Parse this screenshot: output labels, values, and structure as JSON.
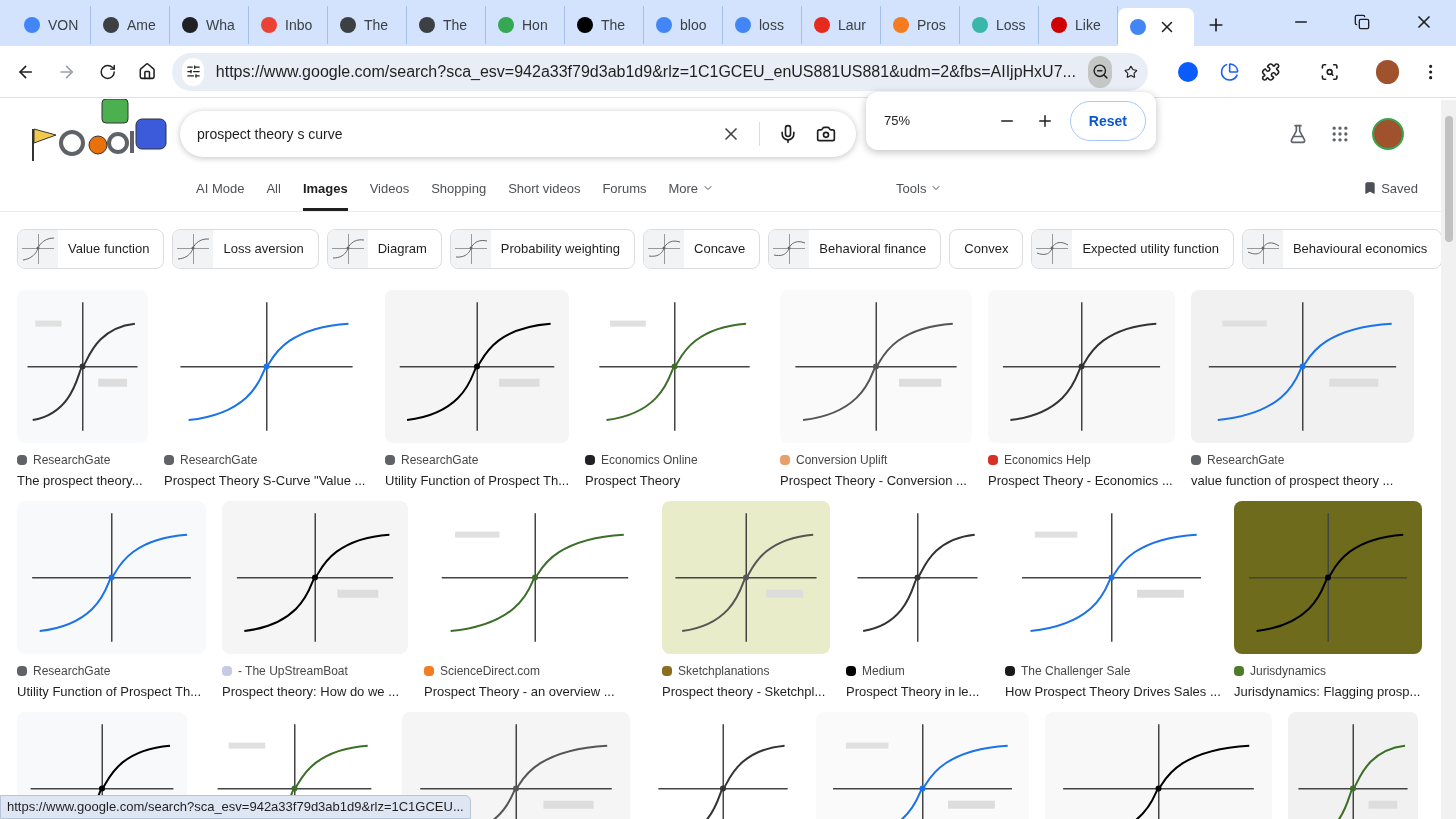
{
  "browser_tabs": [
    {
      "title": "VON",
      "selected": false,
      "color": "#4285f4"
    },
    {
      "title": "Ame",
      "selected": false,
      "color": "#3c4043"
    },
    {
      "title": "Wha",
      "selected": false,
      "color": "#202124"
    },
    {
      "title": "Inbo",
      "selected": false,
      "color": "#ea4335"
    },
    {
      "title": "The",
      "selected": false,
      "color": "#3c4043"
    },
    {
      "title": "The",
      "selected": false,
      "color": "#3c4043"
    },
    {
      "title": "Hon",
      "selected": false,
      "color": "#34a853"
    },
    {
      "title": "The",
      "selected": false,
      "color": "#000000"
    },
    {
      "title": "bloo",
      "selected": false,
      "color": "#4285f4"
    },
    {
      "title": "loss",
      "selected": false,
      "color": "#4285f4"
    },
    {
      "title": "Laur",
      "selected": false,
      "color": "#e62b1e"
    },
    {
      "title": "Pros",
      "selected": false,
      "color": "#f47b20"
    },
    {
      "title": "Loss",
      "selected": false,
      "color": "#3ab7a8"
    },
    {
      "title": "Like",
      "selected": false,
      "color": "#d00000"
    },
    {
      "selected": true,
      "color": "#4285f4"
    }
  ],
  "address_bar": {
    "url": "https://www.google.com/search?sca_esv=942a33f79d3ab1d9&rlz=1C1GCEU_enUS881US881&udm=2&fbs=AIIjpHxU7..."
  },
  "zoom_popup": {
    "value": "75%",
    "reset": "Reset"
  },
  "search": {
    "query": "prospect theory s curve"
  },
  "nav_tabs": [
    {
      "label": "AI Mode",
      "selected": false
    },
    {
      "label": "All",
      "selected": false
    },
    {
      "label": "Images",
      "selected": true
    },
    {
      "label": "Videos",
      "selected": false
    },
    {
      "label": "Shopping",
      "selected": false
    },
    {
      "label": "Short videos",
      "selected": false
    },
    {
      "label": "Forums",
      "selected": false
    },
    {
      "label": "More",
      "selected": false
    }
  ],
  "tools": "Tools",
  "saved": "Saved",
  "chips": [
    {
      "label": "Value function",
      "kind": "with_picture"
    },
    {
      "label": "Loss aversion",
      "kind": "with_picture"
    },
    {
      "label": "Diagram",
      "kind": "with_picture"
    },
    {
      "label": "Probability weighting",
      "kind": "with_picture"
    },
    {
      "label": "Concave",
      "kind": "with_picture"
    },
    {
      "label": "Behavioral finance",
      "kind": "with_picture"
    },
    {
      "label": "Convex",
      "kind": "plain"
    },
    {
      "label": "Expected utility function",
      "kind": "with_picture"
    },
    {
      "label": "Behavioural economics",
      "kind": "with_picture"
    }
  ],
  "result_rows": [
    {
      "items": [
        {
          "kind": "result",
          "source": "ResearchGate",
          "title": "The prospect theory...",
          "color": "#5f6368"
        },
        {
          "kind": "result",
          "source": "ResearchGate",
          "title": "Prospect Theory S-Curve \"Value ...",
          "color": "#5f6368"
        },
        {
          "kind": "result",
          "source": "ResearchGate",
          "title": "Utility Function of Prospect Th...",
          "color": "#5f6368"
        },
        {
          "kind": "result",
          "source": "Economics Online",
          "title": "Prospect Theory",
          "color": "#202124"
        },
        {
          "kind": "result",
          "source": "Conversion Uplift",
          "title": "Prospect Theory - Conversion ...",
          "color": "#e8a06b"
        },
        {
          "kind": "result",
          "source": "Economics Help",
          "title": "Prospect Theory - Economics ...",
          "color": "#d93025"
        },
        {
          "kind": "result",
          "source": "ResearchGate",
          "title": "value function of prospect theory ...",
          "color": "#5f6368"
        }
      ]
    },
    {
      "items": [
        {
          "kind": "result",
          "source": "ResearchGate",
          "title": "Utility Function of Prospect Th...",
          "color": "#5f6368"
        },
        {
          "kind": "result",
          "source": "- The UpStreamBoat",
          "title": "Prospect theory: How do we ...",
          "color": "#c5cae9"
        },
        {
          "kind": "result",
          "source": "ScienceDirect.com",
          "title": "Prospect Theory - an overview ...",
          "color": "#f47b20"
        },
        {
          "kind": "result",
          "source": "Sketchplanations",
          "title": "Prospect theory - Sketchpl...",
          "color": "#8a6d1f"
        },
        {
          "kind": "result",
          "source": "Medium",
          "title": "Prospect Theory in le...",
          "color": "#000000"
        },
        {
          "kind": "result",
          "source": "The Challenger Sale",
          "title": "How Prospect Theory Drives Sales ...",
          "color": "#1a1a1a"
        },
        {
          "kind": "result",
          "source": "Jurisdynamics",
          "title": "Jurisdynamics: Flagging prosp...",
          "color": "#4f7a2a"
        }
      ]
    },
    {
      "items": [
        {
          "kind": "picture"
        },
        {
          "kind": "picture"
        },
        {
          "kind": "picture"
        },
        {
          "kind": "picture"
        },
        {
          "kind": "picture"
        },
        {
          "kind": "picture"
        },
        {
          "kind": "picture"
        }
      ]
    }
  ],
  "status_bar": {
    "url": "https://www.google.com/search?sca_esv=942a33f79d3ab1d9&rlz=1C1GCEU..."
  }
}
